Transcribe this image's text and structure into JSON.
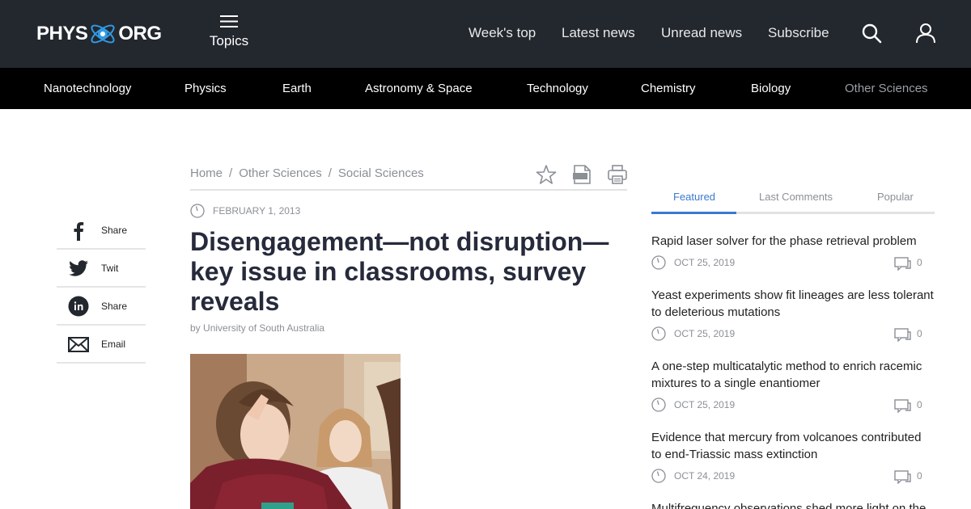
{
  "header": {
    "logo_left": "PHYS",
    "logo_right": "ORG",
    "topics_label": "Topics",
    "nav": [
      "Week's top",
      "Latest news",
      "Unread news",
      "Subscribe"
    ],
    "icons": [
      "search-icon",
      "user-icon",
      "menu-icon"
    ]
  },
  "categories": [
    "Nanotechnology",
    "Physics",
    "Earth",
    "Astronomy & Space",
    "Technology",
    "Chemistry",
    "Biology",
    "Other Sciences"
  ],
  "share": [
    {
      "label": "Share",
      "icon": "facebook-icon"
    },
    {
      "label": "Twit",
      "icon": "twitter-icon"
    },
    {
      "label": "Share",
      "icon": "linkedin-icon"
    },
    {
      "label": "Email",
      "icon": "email-icon"
    }
  ],
  "article": {
    "breadcrumb": [
      "Home",
      "Other Sciences",
      "Social Sciences"
    ],
    "breadcrumb_sep": "/",
    "tools": [
      "star-icon",
      "pdf-icon",
      "print-icon"
    ],
    "date": "FEBRUARY 1, 2013",
    "title": "Disengagement—not disruption—key issue in classrooms, survey reveals",
    "byline_prefix": "by",
    "byline_source": "University of South Australia"
  },
  "sidebar": {
    "tabs": [
      "Featured",
      "Last Comments",
      "Popular"
    ],
    "active_tab": "Featured",
    "stories": [
      {
        "title": "Rapid laser solver for the phase retrieval problem",
        "date": "OCT 25, 2019",
        "comments": "0"
      },
      {
        "title": "Yeast experiments show fit lineages are less tolerant to deleterious mutations",
        "date": "OCT 25, 2019",
        "comments": "0"
      },
      {
        "title": "A one-step multicatalytic method to enrich racemic mixtures to a single enantiomer",
        "date": "OCT 25, 2019",
        "comments": "0"
      },
      {
        "title": "Evidence that mercury from volcanoes contributed to end-Triassic mass extinction",
        "date": "OCT 24, 2019",
        "comments": "0"
      },
      {
        "title": "Multifrequency observations shed more light on the",
        "date": "",
        "comments": ""
      }
    ]
  },
  "colors": {
    "header_bg": "#23272e",
    "category_bg": "#000000",
    "accent": "#3b79d0",
    "muted_text": "#8b8f96",
    "headline": "#262a3b"
  }
}
